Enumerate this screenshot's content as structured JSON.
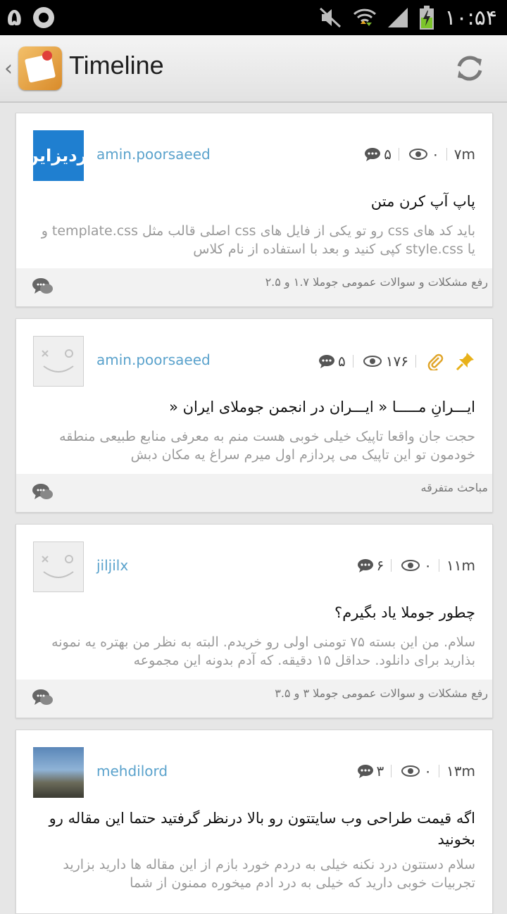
{
  "status_bar": {
    "left_digit": "۵",
    "time": "۱۰:۵۴"
  },
  "action_bar": {
    "back_icon": "chevron-left-icon",
    "logo_icon": "app-logo-icon",
    "title": "Timeline",
    "refresh_icon": "refresh-icon"
  },
  "posts": [
    {
      "avatar_text": "آردیزاین",
      "username": "amin.poorsaeed",
      "comments": "۵",
      "views": "۰",
      "time": "۷m",
      "title": "پاپ آپ کرن متن",
      "excerpt": "باید کد های css رو تو یکی از فایل های css اصلی قالب مثل template.css و یا style.css کپی کنید و بعد با استفاده از نام کلاس",
      "category": "رفع مشکلات و سوالات عمومی جوملا ۱.۷ و ۲.۵"
    },
    {
      "username": "amin.poorsaeed",
      "comments": "۵",
      "views": "۱۷۶",
      "pinned": true,
      "attachment": true,
      "title": "ایـــرانِ مـــــا  «  ایـــران در انجمن جوملای ایران  «",
      "excerpt": "حجت جان واقعا تاپیک خیلی خوبی هست منم به معرفی منابع طبیعی منطقه خودمون تو این تاپیک می پردازم اول میرم سراغ یه مکان دبش",
      "category": "مباحث متفرقه"
    },
    {
      "username": "jiljilx",
      "comments": "۶",
      "views": "۰",
      "time": "۱۱m",
      "title": "چطور جوملا یاد بگیرم؟",
      "excerpt": "سلام. من این بسته ۷۵ تومنی اولی رو خریدم. البته به نظر من بهتره یه نمونه بذارید برای دانلود. حداقل ۱۵ دقیقه. که آدم بدونه این مجموعه",
      "category": "رفع مشکلات و سوالات عمومی جوملا ۳ و ۳.۵"
    },
    {
      "username": "mehdilord",
      "comments": "۳",
      "views": "۰",
      "time": "۱۳m",
      "title": "اگه قیمت طراحی وب سایتتون رو بالا درنظر گرفتید حتما این مقاله رو بخونید",
      "excerpt": "سلام دستتون درد نکنه خیلی به دردم خورد بازم از این مقاله ها دارید بزارید تجربیات خوبی دارید که خیلی به درد ادم میخوره ممنون از شما"
    }
  ]
}
